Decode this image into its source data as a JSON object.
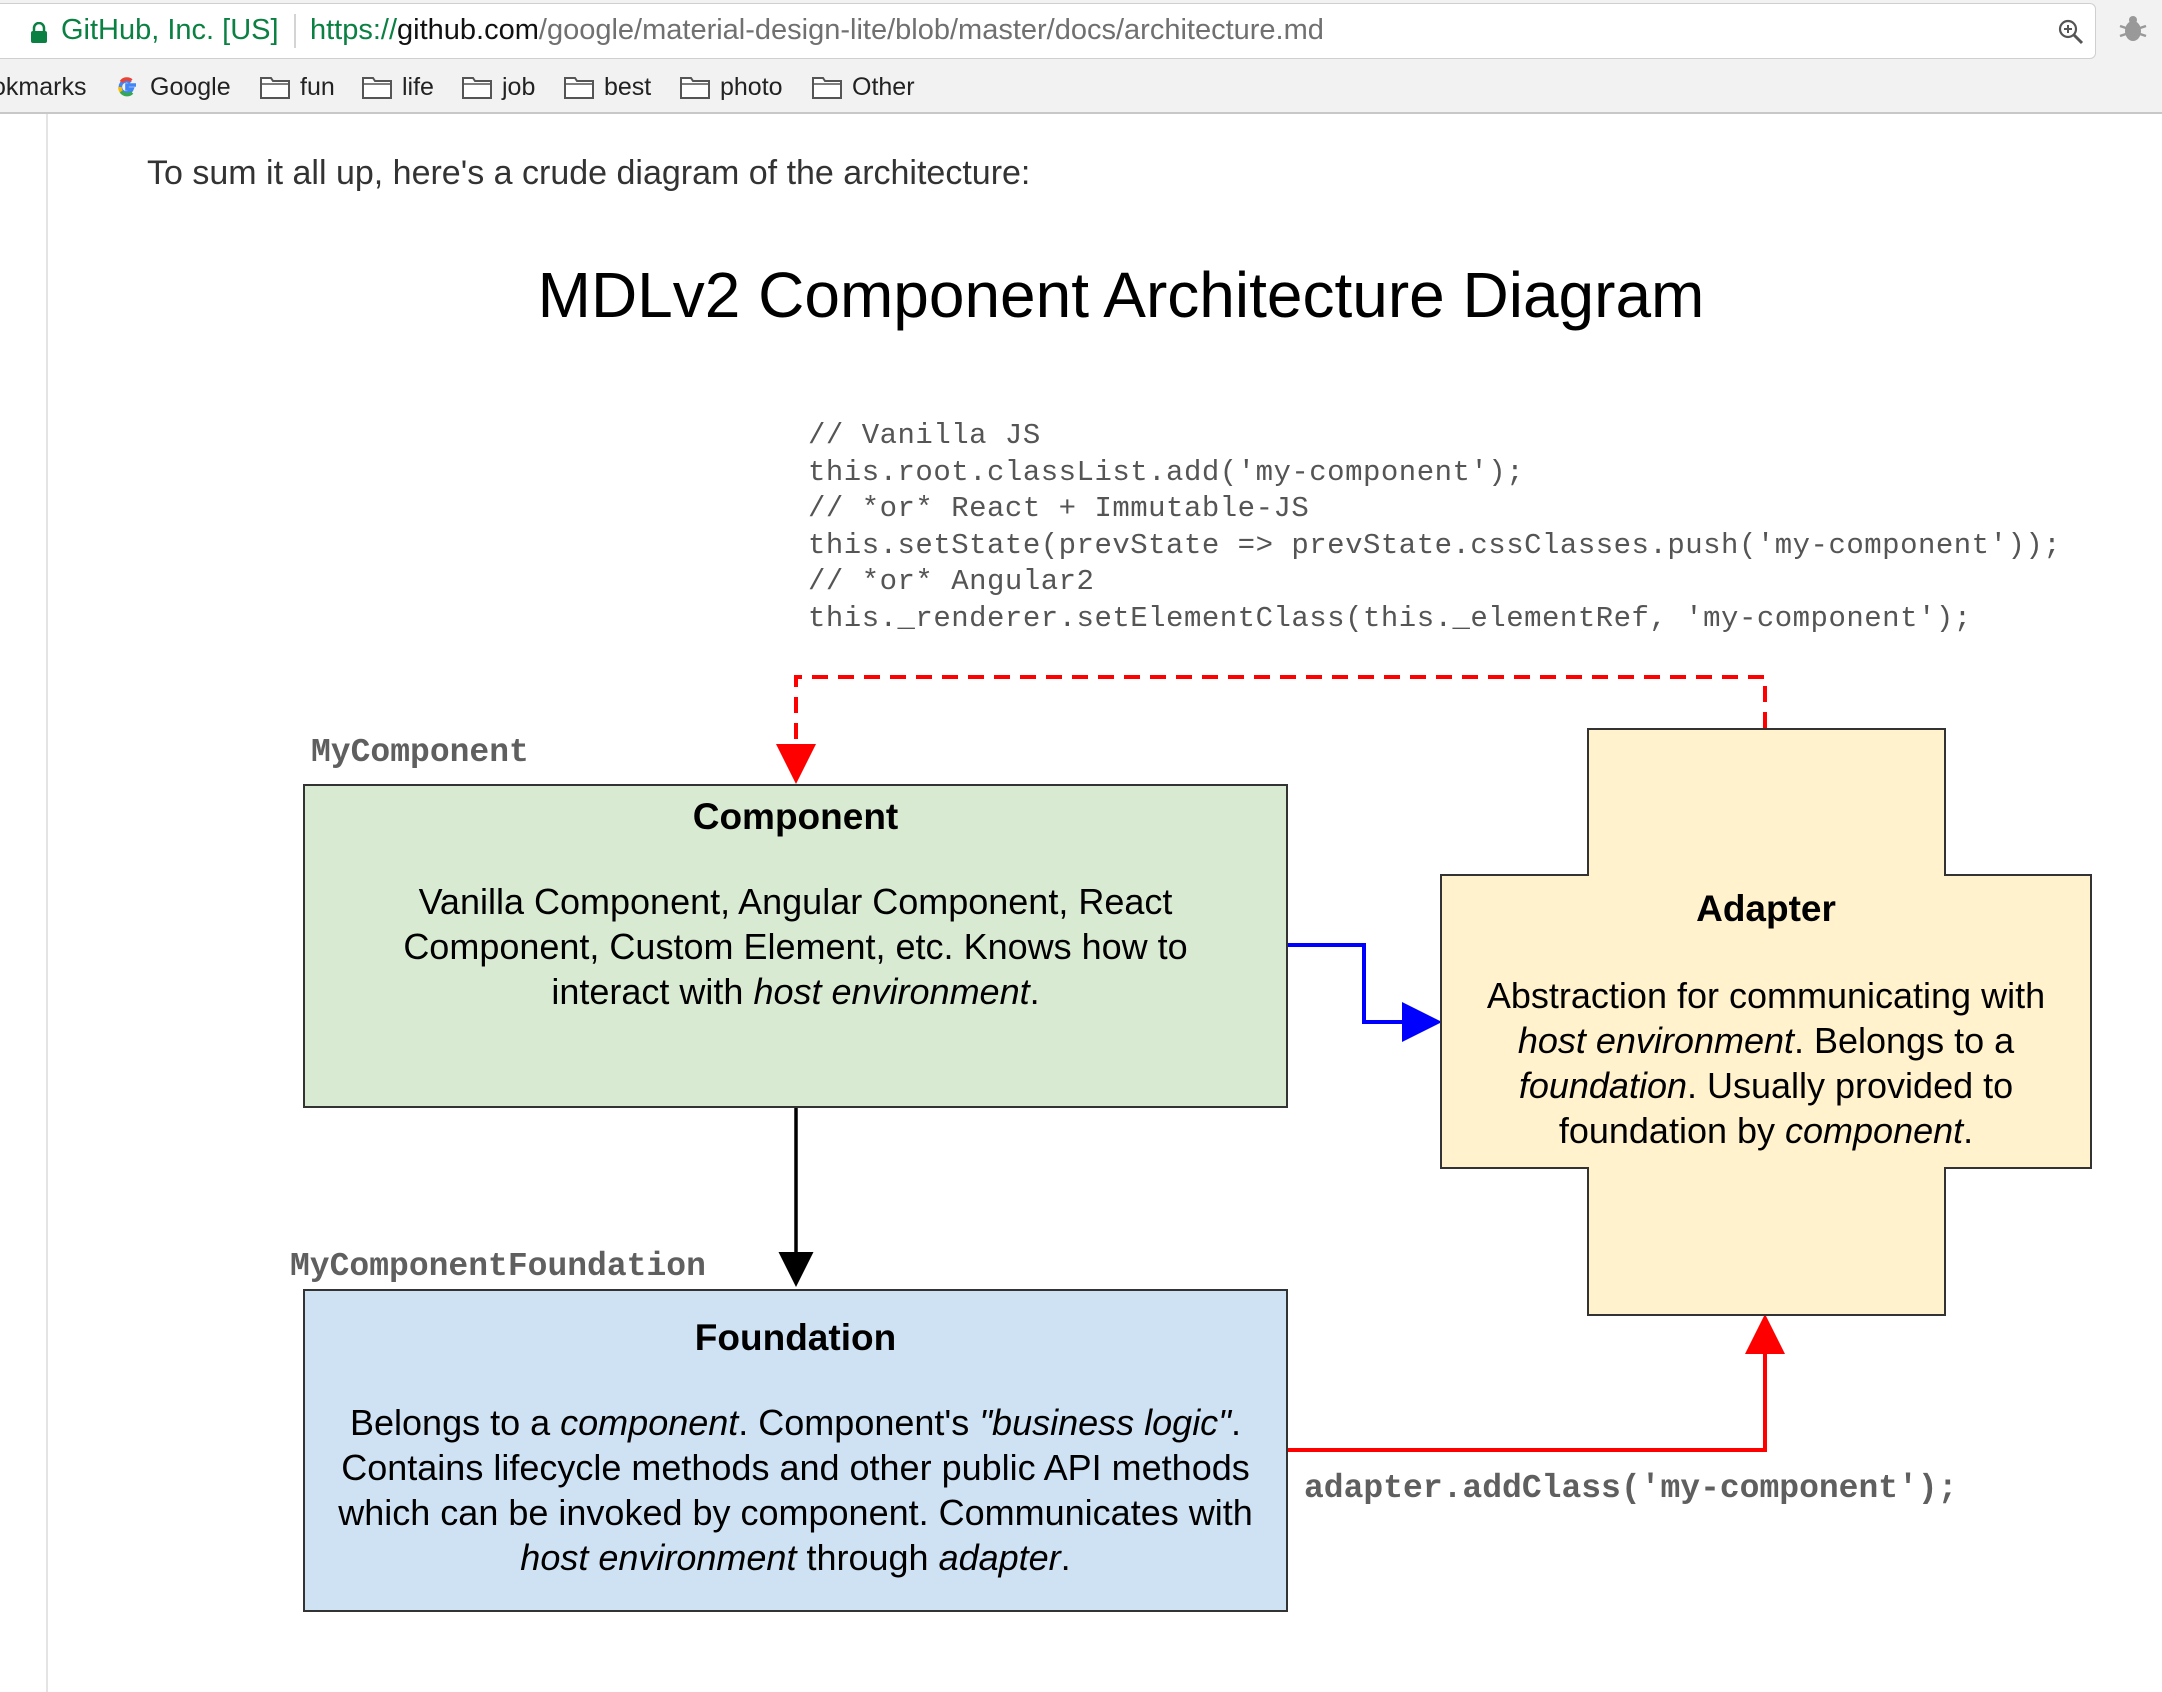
{
  "browser": {
    "site_identity": "GitHub, Inc. [US]",
    "url_scheme": "https://",
    "url_host": "github.com",
    "url_path": "/google/material-design-lite/blob/master/docs/architecture.md",
    "icons": [
      "lock-icon",
      "zoom-icon",
      "bug-icon"
    ],
    "bookmarks": [
      {
        "label": "okmarks",
        "icon": "none"
      },
      {
        "label": "Google",
        "icon": "google-icon"
      },
      {
        "label": "fun",
        "icon": "folder-icon"
      },
      {
        "label": "life",
        "icon": "folder-icon"
      },
      {
        "label": "job",
        "icon": "folder-icon"
      },
      {
        "label": "best",
        "icon": "folder-icon"
      },
      {
        "label": "photo",
        "icon": "folder-icon"
      },
      {
        "label": "Other",
        "icon": "folder-icon"
      }
    ]
  },
  "page": {
    "intro_text": "To sum it all up, here's a crude diagram of the architecture:"
  },
  "diagram": {
    "title": "MDLv2 Component Architecture Diagram",
    "code_lines": [
      "// Vanilla JS",
      "this.root.classList.add('my-component');",
      "// *or* React + Immutable-JS",
      "this.setState(prevState => prevState.cssClasses.push('my-component'));",
      "// *or* Angular2",
      "this._renderer.setElementClass(this._elementRef, 'my-component');"
    ],
    "component": {
      "class_name": "MyComponent",
      "title": "Component",
      "body_html": "Vanilla Component, Angular Component, React Component, Custom Element, etc. Knows how to interact with <i>host environment</i>."
    },
    "foundation": {
      "class_name": "MyComponentFoundation",
      "title": "Foundation",
      "body_html": "Belongs to a <i>component</i>. Component's <i>\"business logic\"</i>. Contains lifecycle methods and other public API methods which can be invoked by component. Communicates with <i>host environment</i> through <i>adapter</i>."
    },
    "adapter": {
      "title": "Adapter",
      "body_html": "Abstraction for communicating with <i>host environment</i>. Belongs to a <i>foundation</i>. Usually provided to foundation by <i>component</i>."
    },
    "adapter_call": "adapter.addClass('my-component');",
    "colors": {
      "component_fill": "#d9ead3",
      "foundation_fill": "#cfe2f3",
      "adapter_fill": "#fff2cc",
      "red_arrow": "#ff0000",
      "blue_arrow": "#0000ff",
      "black_arrow": "#000000"
    }
  }
}
